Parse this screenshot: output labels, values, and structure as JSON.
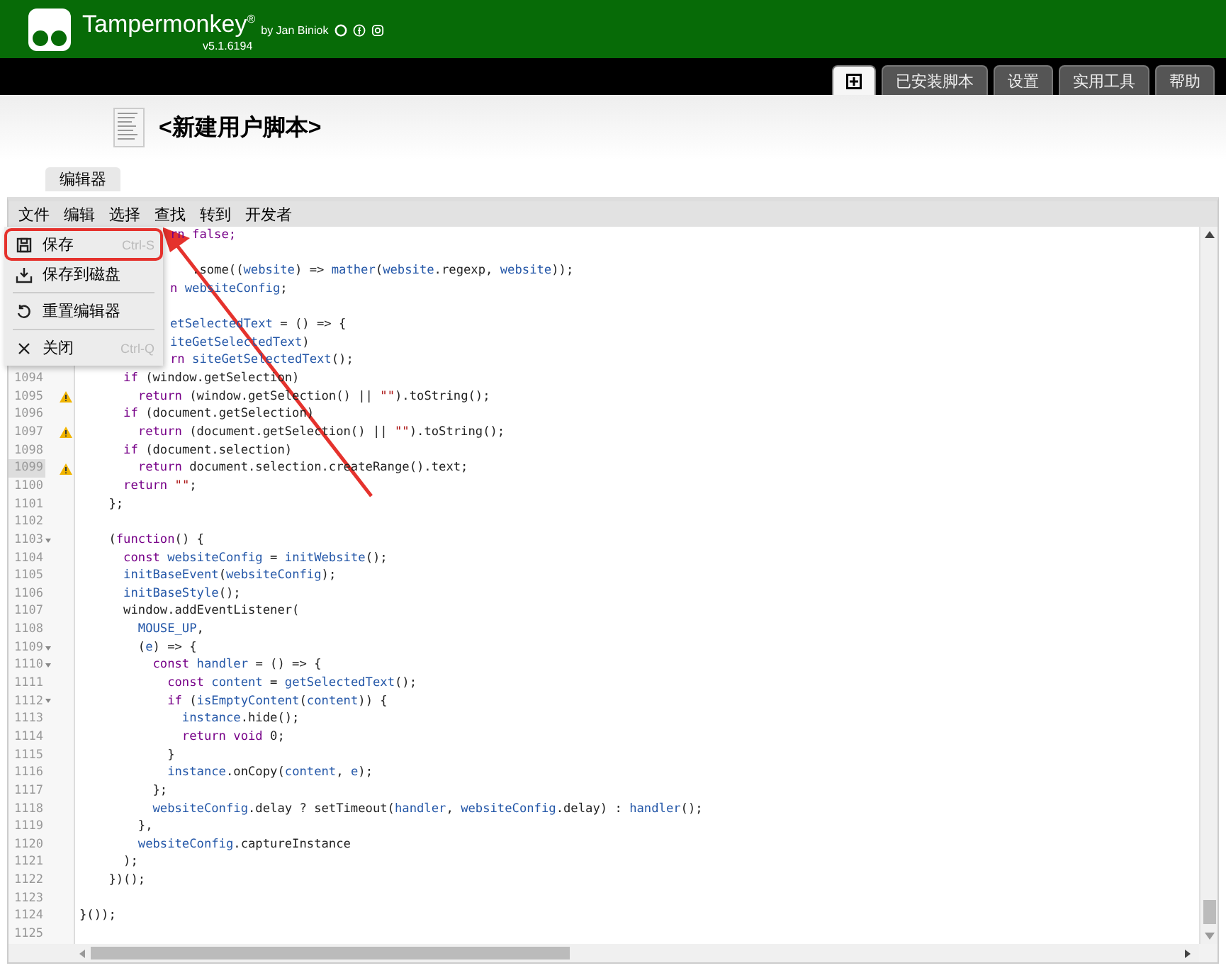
{
  "header": {
    "title": "Tampermonkey$^{®}$",
    "byline": "by Jan Biniok",
    "version": "v5.1.6194"
  },
  "nav_tabs": [
    {
      "kind": "icon",
      "selected": true
    },
    {
      "kind": "text",
      "label": "已安装脚本",
      "selected": false
    },
    {
      "kind": "text",
      "label": "设置",
      "selected": false
    },
    {
      "kind": "text",
      "label": "实用工具",
      "selected": false
    },
    {
      "kind": "text",
      "label": "帮助",
      "selected": false
    }
  ],
  "script": {
    "title": "<新建用户脚本>"
  },
  "sub_tabs": [
    {
      "label": "编辑器",
      "selected": true
    }
  ],
  "editor": {
    "menubar": [
      "文件",
      "编辑",
      "选择",
      "查找",
      "转到",
      "开发者"
    ],
    "file_menu": [
      {
        "kind": "save",
        "label": "保存",
        "shortcut": "Ctrl-S",
        "highlighted": true
      },
      {
        "kind": "export",
        "label": "保存到磁盘",
        "highlighted": false
      },
      {
        "kind": "separator"
      },
      {
        "kind": "reset",
        "label": "重置编辑器",
        "highlighted": false
      },
      {
        "kind": "separator"
      },
      {
        "kind": "close",
        "label": "关闭",
        "shortcut": "Ctrl-Q",
        "highlighted": false
      }
    ],
    "lines": [
      {
        "kind": "covered",
        "code": [
          {
            "text": "rn false;",
            "kind": "kw"
          }
        ]
      },
      {
        "kind": "covered"
      },
      {
        "kind": "covered",
        "code": [
          {
            "text": "   .some((",
            "kind": "p"
          },
          {
            "text": "website",
            "kind": "var"
          },
          {
            "text": ") => ",
            "kind": "p"
          },
          {
            "text": "mather",
            "kind": "var"
          },
          {
            "text": "(",
            "kind": "p"
          },
          {
            "text": "website",
            "kind": "var"
          },
          {
            "text": ".regexp, ",
            "kind": "p"
          },
          {
            "text": "website",
            "kind": "var"
          },
          {
            "text": "));",
            "kind": "p"
          }
        ]
      },
      {
        "kind": "covered",
        "code": [
          {
            "text": "n ",
            "kind": "kw"
          },
          {
            "text": "websiteConfig",
            "kind": "var"
          },
          {
            "text": ";",
            "kind": "p"
          }
        ]
      },
      {
        "kind": "covered"
      },
      {
        "kind": "covered",
        "code": [
          {
            "text": "etSelectedText",
            "kind": "var"
          },
          {
            "text": " = () => {",
            "kind": "p"
          }
        ]
      },
      {
        "kind": "covered",
        "code": [
          {
            "text": "iteGetSelectedText",
            "kind": "var"
          },
          {
            "text": ")",
            "kind": "p"
          }
        ]
      },
      {
        "kind": "covered",
        "code": [
          {
            "text": "rn ",
            "kind": "kw"
          },
          {
            "text": "siteGetSelectedText",
            "kind": "var"
          },
          {
            "text": "();",
            "kind": "p"
          }
        ]
      },
      {
        "kind": "line",
        "number": "1094",
        "fold": false,
        "warning": false,
        "selected": false,
        "code": [
          {
            "text": "      if",
            "kind": "kw"
          },
          {
            "text": " (window.getSelection)",
            "kind": "p"
          }
        ]
      },
      {
        "kind": "line",
        "number": "1095",
        "fold": false,
        "warning": true,
        "selected": false,
        "code": [
          {
            "text": "        return",
            "kind": "kw"
          },
          {
            "text": " (window.getSelection() || ",
            "kind": "p"
          },
          {
            "text": "\"\"",
            "kind": "str"
          },
          {
            "text": ").toString();",
            "kind": "p"
          }
        ]
      },
      {
        "kind": "line",
        "number": "1096",
        "fold": false,
        "warning": false,
        "selected": false,
        "code": [
          {
            "text": "      if",
            "kind": "kw"
          },
          {
            "text": " (document.getSelection)",
            "kind": "p"
          }
        ]
      },
      {
        "kind": "line",
        "number": "1097",
        "fold": false,
        "warning": true,
        "selected": false,
        "code": [
          {
            "text": "        return",
            "kind": "kw"
          },
          {
            "text": " (document.getSelection() || ",
            "kind": "p"
          },
          {
            "text": "\"\"",
            "kind": "str"
          },
          {
            "text": ").toString();",
            "kind": "p"
          }
        ]
      },
      {
        "kind": "line",
        "number": "1098",
        "fold": false,
        "warning": false,
        "selected": false,
        "code": [
          {
            "text": "      if",
            "kind": "kw"
          },
          {
            "text": " (document.selection)",
            "kind": "p"
          }
        ]
      },
      {
        "kind": "line",
        "number": "1099",
        "fold": false,
        "warning": true,
        "selected": true,
        "code": [
          {
            "text": "        return",
            "kind": "kw"
          },
          {
            "text": " document.selection.createRange().text;",
            "kind": "p"
          }
        ]
      },
      {
        "kind": "line",
        "number": "1100",
        "fold": false,
        "warning": false,
        "selected": false,
        "code": [
          {
            "text": "      return ",
            "kind": "kw"
          },
          {
            "text": "\"\"",
            "kind": "str"
          },
          {
            "text": ";",
            "kind": "p"
          }
        ]
      },
      {
        "kind": "line",
        "number": "1101",
        "fold": false,
        "warning": false,
        "selected": false,
        "code": [
          {
            "text": "    };",
            "kind": "p"
          }
        ]
      },
      {
        "kind": "line",
        "number": "1102",
        "fold": false,
        "warning": false,
        "selected": false
      },
      {
        "kind": "line",
        "number": "1103",
        "fold": true,
        "warning": false,
        "selected": false,
        "code": [
          {
            "text": "    (",
            "kind": "p"
          },
          {
            "text": "function",
            "kind": "kw"
          },
          {
            "text": "() {",
            "kind": "p"
          }
        ]
      },
      {
        "kind": "line",
        "number": "1104",
        "fold": false,
        "warning": false,
        "selected": false,
        "code": [
          {
            "text": "      const ",
            "kind": "kw"
          },
          {
            "text": "websiteConfig",
            "kind": "var"
          },
          {
            "text": " = ",
            "kind": "p"
          },
          {
            "text": "initWebsite",
            "kind": "var"
          },
          {
            "text": "();",
            "kind": "p"
          }
        ]
      },
      {
        "kind": "line",
        "number": "1105",
        "fold": false,
        "warning": false,
        "selected": false,
        "code": [
          {
            "text": "      initBaseEvent",
            "kind": "var"
          },
          {
            "text": "(",
            "kind": "p"
          },
          {
            "text": "websiteConfig",
            "kind": "var"
          },
          {
            "text": ");",
            "kind": "p"
          }
        ]
      },
      {
        "kind": "line",
        "number": "1106",
        "fold": false,
        "warning": false,
        "selected": false,
        "code": [
          {
            "text": "      initBaseStyle",
            "kind": "var"
          },
          {
            "text": "();",
            "kind": "p"
          }
        ]
      },
      {
        "kind": "line",
        "number": "1107",
        "fold": false,
        "warning": false,
        "selected": false,
        "code": [
          {
            "text": "      window.addEventListener(",
            "kind": "p"
          }
        ]
      },
      {
        "kind": "line",
        "number": "1108",
        "fold": false,
        "warning": false,
        "selected": false,
        "code": [
          {
            "text": "        MOUSE_UP",
            "kind": "var"
          },
          {
            "text": ",",
            "kind": "p"
          }
        ]
      },
      {
        "kind": "line",
        "number": "1109",
        "fold": true,
        "warning": false,
        "selected": false,
        "code": [
          {
            "text": "        (",
            "kind": "p"
          },
          {
            "text": "e",
            "kind": "var"
          },
          {
            "text": ") => {",
            "kind": "p"
          }
        ]
      },
      {
        "kind": "line",
        "number": "1110",
        "fold": true,
        "warning": false,
        "selected": false,
        "code": [
          {
            "text": "          const ",
            "kind": "kw"
          },
          {
            "text": "handler",
            "kind": "var"
          },
          {
            "text": " = () => {",
            "kind": "p"
          }
        ]
      },
      {
        "kind": "line",
        "number": "1111",
        "fold": false,
        "warning": false,
        "selected": false,
        "code": [
          {
            "text": "            const ",
            "kind": "kw"
          },
          {
            "text": "content",
            "kind": "var"
          },
          {
            "text": " = ",
            "kind": "p"
          },
          {
            "text": "getSelectedText",
            "kind": "var"
          },
          {
            "text": "();",
            "kind": "p"
          }
        ]
      },
      {
        "kind": "line",
        "number": "1112",
        "fold": true,
        "warning": false,
        "selected": false,
        "code": [
          {
            "text": "            if",
            "kind": "kw"
          },
          {
            "text": " (",
            "kind": "p"
          },
          {
            "text": "isEmptyContent",
            "kind": "var"
          },
          {
            "text": "(",
            "kind": "p"
          },
          {
            "text": "content",
            "kind": "var"
          },
          {
            "text": ")) {",
            "kind": "p"
          }
        ]
      },
      {
        "kind": "line",
        "number": "1113",
        "fold": false,
        "warning": false,
        "selected": false,
        "code": [
          {
            "text": "              instance",
            "kind": "var"
          },
          {
            "text": ".hide();",
            "kind": "p"
          }
        ]
      },
      {
        "kind": "line",
        "number": "1114",
        "fold": false,
        "warning": false,
        "selected": false,
        "code": [
          {
            "text": "              return void",
            "kind": "kw"
          },
          {
            "text": " 0;",
            "kind": "p"
          }
        ]
      },
      {
        "kind": "line",
        "number": "1115",
        "fold": false,
        "warning": false,
        "selected": false,
        "code": [
          {
            "text": "            }",
            "kind": "p"
          }
        ]
      },
      {
        "kind": "line",
        "number": "1116",
        "fold": false,
        "warning": false,
        "selected": false,
        "code": [
          {
            "text": "            instance",
            "kind": "var"
          },
          {
            "text": ".onCopy(",
            "kind": "p"
          },
          {
            "text": "content",
            "kind": "var"
          },
          {
            "text": ", ",
            "kind": "p"
          },
          {
            "text": "e",
            "kind": "var"
          },
          {
            "text": ");",
            "kind": "p"
          }
        ]
      },
      {
        "kind": "line",
        "number": "1117",
        "fold": false,
        "warning": false,
        "selected": false,
        "code": [
          {
            "text": "          };",
            "kind": "p"
          }
        ]
      },
      {
        "kind": "line",
        "number": "1118",
        "fold": false,
        "warning": false,
        "selected": false,
        "code": [
          {
            "text": "          websiteConfig",
            "kind": "var"
          },
          {
            "text": ".delay ? setTimeout(",
            "kind": "p"
          },
          {
            "text": "handler",
            "kind": "var"
          },
          {
            "text": ", ",
            "kind": "p"
          },
          {
            "text": "websiteConfig",
            "kind": "var"
          },
          {
            "text": ".delay) : ",
            "kind": "p"
          },
          {
            "text": "handler",
            "kind": "var"
          },
          {
            "text": "();",
            "kind": "p"
          }
        ]
      },
      {
        "kind": "line",
        "number": "1119",
        "fold": false,
        "warning": false,
        "selected": false,
        "code": [
          {
            "text": "        },",
            "kind": "p"
          }
        ]
      },
      {
        "kind": "line",
        "number": "1120",
        "fold": false,
        "warning": false,
        "selected": false,
        "code": [
          {
            "text": "        websiteConfig",
            "kind": "var"
          },
          {
            "text": ".captureInstance",
            "kind": "p"
          }
        ]
      },
      {
        "kind": "line",
        "number": "1121",
        "fold": false,
        "warning": false,
        "selected": false,
        "code": [
          {
            "text": "      );",
            "kind": "p"
          }
        ]
      },
      {
        "kind": "line",
        "number": "1122",
        "fold": false,
        "warning": false,
        "selected": false,
        "code": [
          {
            "text": "    })();",
            "kind": "p"
          }
        ]
      },
      {
        "kind": "line",
        "number": "1123",
        "fold": false,
        "warning": false,
        "selected": false
      },
      {
        "kind": "line",
        "number": "1124",
        "fold": false,
        "warning": false,
        "selected": false,
        "code": [
          {
            "text": "}());",
            "kind": "p"
          }
        ]
      },
      {
        "kind": "line",
        "number": "1125",
        "fold": false,
        "warning": false,
        "selected": false
      }
    ]
  }
}
